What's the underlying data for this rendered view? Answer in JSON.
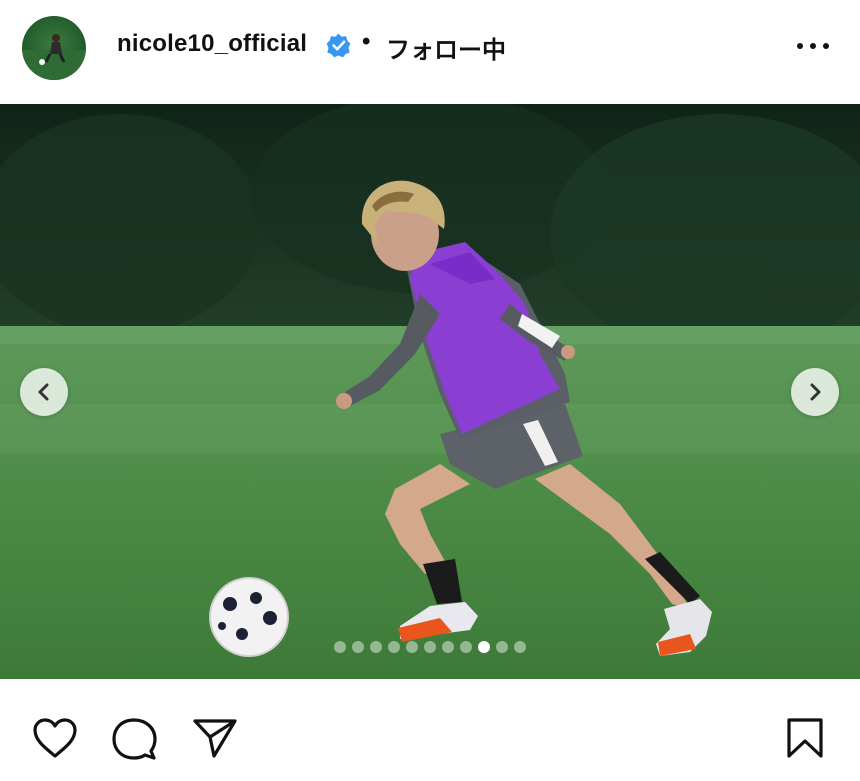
{
  "post": {
    "username": "nicole10_official",
    "verified": true,
    "separator": "•",
    "follow_status": "フォロー中"
  },
  "media": {
    "carousel_total": 11,
    "carousel_active_index": 8
  },
  "icons": {
    "avatar": "profile-avatar",
    "verified": "verified-badge-icon",
    "more": "more-options-icon",
    "prev": "chevron-left-icon",
    "next": "chevron-right-icon",
    "like": "heart-icon",
    "comment": "comment-bubble-icon",
    "share": "paper-plane-icon",
    "save": "bookmark-icon"
  },
  "colors": {
    "verified_blue": "#3897f0",
    "text": "#111111"
  }
}
